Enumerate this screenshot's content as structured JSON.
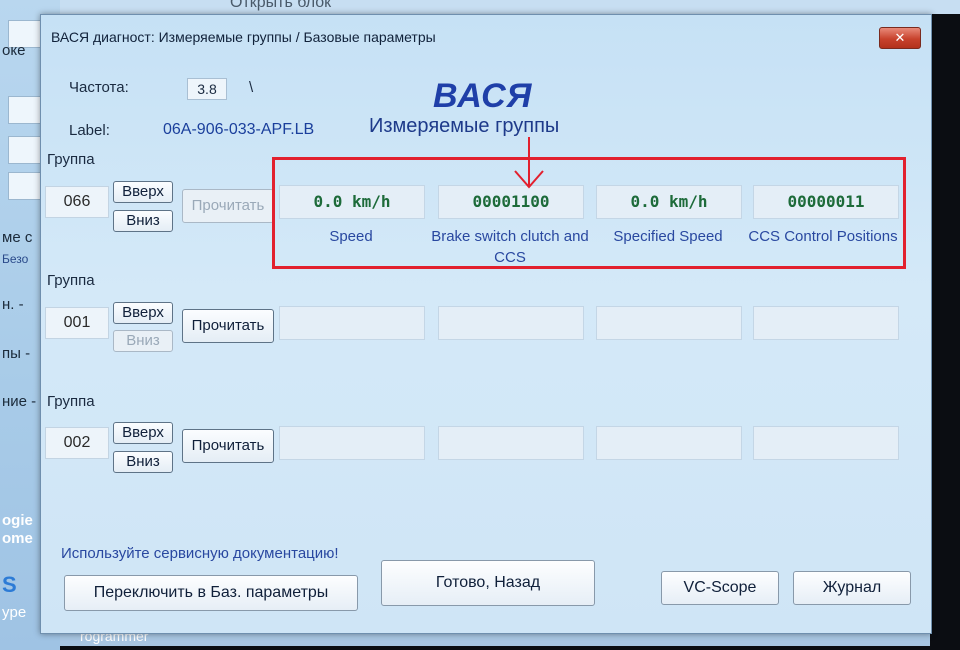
{
  "background": {
    "top_ghost_text": "Открыть блок",
    "left_texts": [
      "оке",
      "ме с",
      "Безо",
      "н. -",
      "пы -",
      "ние -",
      "ogie",
      "ome",
      "S",
      "ype",
      "rogrammer"
    ]
  },
  "window": {
    "title": "ВАСЯ диагност: Измеряемые группы / Базовые параметры",
    "close_label": "✕"
  },
  "header": {
    "frequency_label": "Частота:",
    "frequency_value": "3.8",
    "frequency_indicator": "\\",
    "label_label": "Label:",
    "label_value": "06A-906-033-APF.LB",
    "app_title": "ВАСЯ",
    "app_subtitle": "Измеряемые группы"
  },
  "groups": [
    {
      "label": "Группа",
      "number": "066",
      "up_label": "Вверх",
      "down_label": "Вниз",
      "read_label": "Прочитать",
      "fields": [
        {
          "value": "0.0 km/h",
          "caption": "Speed"
        },
        {
          "value": "00001100",
          "caption": "Brake switch clutch and CCS"
        },
        {
          "value": "0.0 km/h",
          "caption": "Specified Speed"
        },
        {
          "value": "00000011",
          "caption": "CCS Control Positions"
        }
      ]
    },
    {
      "label": "Группа",
      "number": "001",
      "up_label": "Вверх",
      "down_label": "Вниз",
      "read_label": "Прочитать",
      "fields": [
        {
          "value": ""
        },
        {
          "value": ""
        },
        {
          "value": ""
        },
        {
          "value": ""
        }
      ]
    },
    {
      "label": "Группа",
      "number": "002",
      "up_label": "Вверх",
      "down_label": "Вниз",
      "read_label": "Прочитать",
      "fields": [
        {
          "value": ""
        },
        {
          "value": ""
        },
        {
          "value": ""
        },
        {
          "value": ""
        }
      ]
    }
  ],
  "footer": {
    "note": "Используйте сервисную документацию!",
    "switch_button": "Переключить в Баз. параметры",
    "done_button": "Готово, Назад",
    "vcscope_button": "VC-Scope",
    "log_button": "Журнал"
  },
  "colors": {
    "highlight": "#e2202e",
    "value_text": "#1d6b3a",
    "caption_text": "#2948a0",
    "title_text": "#1f3fa8"
  }
}
